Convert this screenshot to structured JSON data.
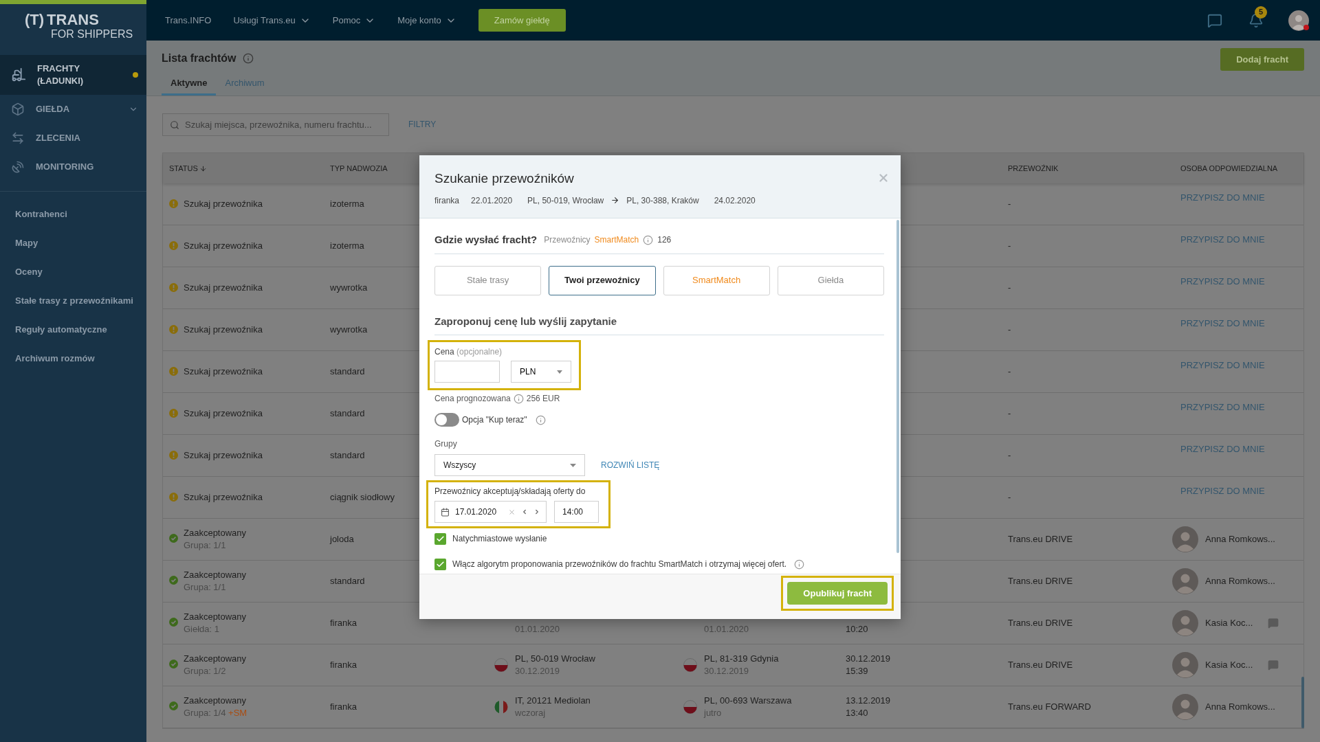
{
  "logo": {
    "mark": "(T)",
    "name": "TRANS",
    "tagline": "FOR SHIPPERS"
  },
  "top_nav": [
    {
      "label": "Trans.INFO",
      "kind": "link"
    },
    {
      "label": "Usługi Trans.eu",
      "kind": "dropdown"
    },
    {
      "label": "Pomoc",
      "kind": "dropdown"
    },
    {
      "label": "Moje konto",
      "kind": "dropdown"
    }
  ],
  "top_button": "Zamów giełdę",
  "notifications": {
    "count": "5"
  },
  "sidebar": {
    "modules": [
      {
        "label": "FRACHTY (ŁADUNKI)",
        "selected": true,
        "dot": true,
        "expandable": false
      },
      {
        "label": "GIEŁDA",
        "selected": false,
        "dot": false,
        "expandable": true
      },
      {
        "label": "ZLECENIA",
        "selected": false,
        "dot": false,
        "expandable": false
      },
      {
        "label": "MONITORING",
        "selected": false,
        "dot": false,
        "expandable": false
      }
    ],
    "links": [
      "Kontrahenci",
      "Mapy",
      "Oceny",
      "Stałe trasy z przewoźnikami",
      "Reguły automatyczne",
      "Archiwum rozmów"
    ]
  },
  "page": {
    "title": "Lista frachtów",
    "add_button": "Dodaj fracht",
    "tabs": [
      {
        "label": "Aktywne",
        "selected": true
      },
      {
        "label": "Archiwum",
        "selected": false
      }
    ],
    "search": {
      "placeholder": "Szukaj miejsca, przewoźnika, numeru frachtu..."
    },
    "filters": "FILTRY"
  },
  "table": {
    "columns": [
      {
        "label": "STATUS",
        "sorted": true
      },
      {
        "label": "TYP NADWOZIA",
        "sorted": false
      },
      {
        "label": "PRZEWOŹNIK",
        "sorted": false
      },
      {
        "label": "OSOBA ODPOWIEDZIALNA",
        "sorted": false
      }
    ],
    "rows": [
      {
        "status": {
          "kind": "searching",
          "label": "Szukaj przewoźnika"
        },
        "body_type": "izoterma",
        "carrier": "-",
        "person": {
          "kind": "assign",
          "label": "PRZYPISZ DO MNIE"
        }
      },
      {
        "status": {
          "kind": "searching",
          "label": "Szukaj przewoźnika"
        },
        "body_type": "izoterma",
        "carrier": "-",
        "person": {
          "kind": "assign",
          "label": "PRZYPISZ DO MNIE"
        }
      },
      {
        "status": {
          "kind": "searching",
          "label": "Szukaj przewoźnika"
        },
        "body_type": "wywrotka",
        "carrier": "-",
        "person": {
          "kind": "assign",
          "label": "PRZYPISZ DO MNIE"
        }
      },
      {
        "status": {
          "kind": "searching",
          "label": "Szukaj przewoźnika"
        },
        "body_type": "wywrotka",
        "carrier": "-",
        "person": {
          "kind": "assign",
          "label": "PRZYPISZ DO MNIE"
        }
      },
      {
        "status": {
          "kind": "searching",
          "label": "Szukaj przewoźnika"
        },
        "body_type": "standard",
        "carrier": "-",
        "person": {
          "kind": "assign",
          "label": "PRZYPISZ DO MNIE"
        }
      },
      {
        "status": {
          "kind": "searching",
          "label": "Szukaj przewoźnika"
        },
        "body_type": "standard",
        "carrier": "-",
        "person": {
          "kind": "assign",
          "label": "PRZYPISZ DO MNIE"
        }
      },
      {
        "status": {
          "kind": "searching",
          "label": "Szukaj przewoźnika"
        },
        "body_type": "standard",
        "carrier": "-",
        "person": {
          "kind": "assign",
          "label": "PRZYPISZ DO MNIE"
        }
      },
      {
        "status": {
          "kind": "searching",
          "label": "Szukaj przewoźnika"
        },
        "body_type": "ciągnik siodłowy",
        "carrier": "-",
        "person": {
          "kind": "assign",
          "label": "PRZYPISZ DO MNIE"
        }
      },
      {
        "status": {
          "kind": "accepted",
          "label": "Zaakceptowany",
          "detail": "Grupa: 1/1"
        },
        "body_type": "joloda",
        "carrier": "Trans.eu DRIVE",
        "person": {
          "kind": "user",
          "name": "Anna Romkows...",
          "chat": false
        }
      },
      {
        "status": {
          "kind": "accepted",
          "label": "Zaakceptowany",
          "detail": "Grupa: 1/1"
        },
        "body_type": "standard",
        "carrier": "Trans.eu DRIVE",
        "person": {
          "kind": "user",
          "name": "Anna Romkows...",
          "chat": false
        }
      },
      {
        "status": {
          "kind": "accepted",
          "label": "Zaakceptowany",
          "detail": "Giełda: 1"
        },
        "body_type": "firanka",
        "loading": {
          "date": "01.01.2020"
        },
        "unloading": {
          "date": "01.01.2020"
        },
        "time": "10:20",
        "carrier": "Trans.eu DRIVE",
        "person": {
          "kind": "user",
          "name": "Kasia Koc...",
          "chat": true
        }
      },
      {
        "status": {
          "kind": "accepted",
          "label": "Zaakceptowany",
          "detail": "Grupa: 1/2"
        },
        "body_type": "firanka",
        "loading": {
          "kind": "pl",
          "place": "PL, 50-019 Wrocław",
          "date": "30.12.2019"
        },
        "unloading": {
          "kind": "pl",
          "place": "PL, 81-319 Gdynia",
          "date": "30.12.2019"
        },
        "date": "30.12.2019",
        "time": "15:39",
        "carrier": "Trans.eu DRIVE",
        "person": {
          "kind": "user",
          "name": "Kasia Koc...",
          "chat": true
        }
      },
      {
        "status": {
          "kind": "accepted",
          "label": "Zaakceptowany",
          "detail": "Grupa: 1/4",
          "tag": "+SM"
        },
        "body_type": "firanka",
        "loading": {
          "kind": "it",
          "place": "IT, 20121 Mediolan",
          "date": "wczoraj"
        },
        "unloading": {
          "kind": "pl",
          "place": "PL, 00-693 Warszawa",
          "date": "jutro"
        },
        "date": "13.12.2019",
        "time": "13:40",
        "carrier": "Trans.eu FORWARD",
        "person": {
          "kind": "user",
          "name": "Anna Romkows...",
          "chat": false
        }
      }
    ]
  },
  "modal": {
    "title": "Szukanie przewoźników",
    "summary": {
      "body_type": "firanka",
      "load_date": "22.01.2020",
      "from": "PL, 50-019, Wrocław",
      "to": "PL, 30-388, Kraków",
      "unload_date": "24.02.2020"
    },
    "target": {
      "heading": "Gdzie wysłać fracht?",
      "carriers_label": "Przewoźnicy",
      "smartmatch": "SmartMatch",
      "count": "126",
      "options": [
        {
          "label": "Stałe trasy",
          "kind": "plain",
          "selected": false
        },
        {
          "label": "Twoi przewoźnicy",
          "kind": "plain",
          "selected": true
        },
        {
          "label": "SmartMatch",
          "kind": "smartmatch",
          "selected": false
        },
        {
          "label": "Giełda",
          "kind": "plain",
          "selected": false
        }
      ]
    },
    "offer": {
      "heading": "Zaproponuj cenę lub wyślij zapytanie",
      "price": {
        "label": "Cena",
        "hint": "(opcjonalne)",
        "currency": "PLN",
        "highlighted": true
      },
      "forecast": {
        "label": "Cena prognozowana",
        "value": "256 EUR"
      },
      "buy_now": {
        "label": "Opcja \"Kup teraz\"",
        "on": false
      },
      "groups": {
        "label": "Grupy",
        "value": "Wszyscy",
        "expand_link": "ROZWIŃ LISTĘ"
      },
      "deadline": {
        "label": "Przewoźnicy akceptują/składają oferty do",
        "date": "17.01.2020",
        "time": "14:00",
        "highlighted": true
      },
      "checks": [
        {
          "label": "Natychmiastowe wysłanie",
          "checked": true,
          "info": false
        },
        {
          "label": "Włącz algorytm proponowania przewoźników do frachtu SmartMatch i otrzymaj więcej ofert.",
          "checked": true,
          "info": true
        }
      ]
    },
    "publish": {
      "label": "Opublikuj fracht",
      "highlighted": true
    }
  }
}
